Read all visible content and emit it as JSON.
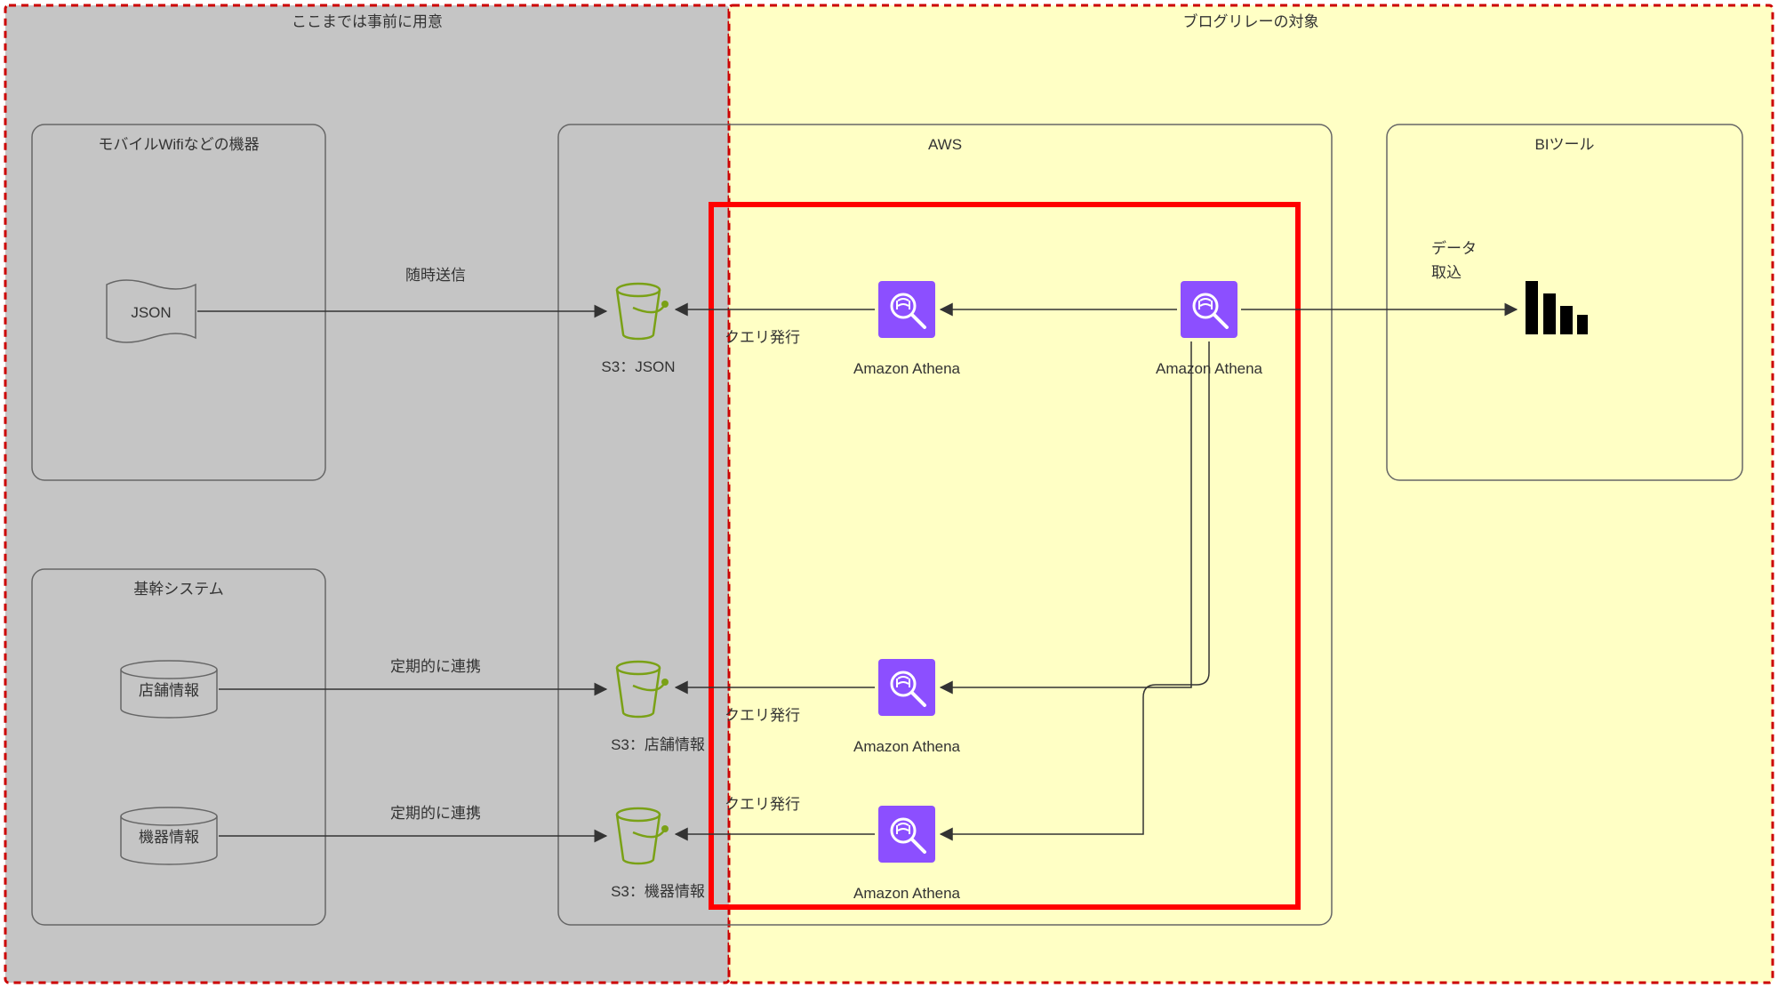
{
  "zones": {
    "left_title": "ここまでは事前に用意",
    "right_title": "ブログリレーの対象"
  },
  "groups": {
    "devices": "モバイルWifiなどの機器",
    "core": "基幹システム",
    "aws": "AWS",
    "bi": "BIツール"
  },
  "nodes": {
    "json_doc": "JSON",
    "db_store": "店舗情報",
    "db_device": "機器情報",
    "s3_json": "S3：JSON",
    "s3_store": "S3：店舗情報",
    "s3_device": "S3：機器情報",
    "athena_json": "Amazon Athena",
    "athena_store": "Amazon Athena",
    "athena_device": "Amazon Athena",
    "athena_hub": "Amazon Athena"
  },
  "edge_labels": {
    "send": "随時送信",
    "sync1": "定期的に連携",
    "sync2": "定期的に連携",
    "q_json": "クエリ発行",
    "q_store": "クエリ発行",
    "q_device": "クエリ発行",
    "ingest": "データ\n取込"
  }
}
